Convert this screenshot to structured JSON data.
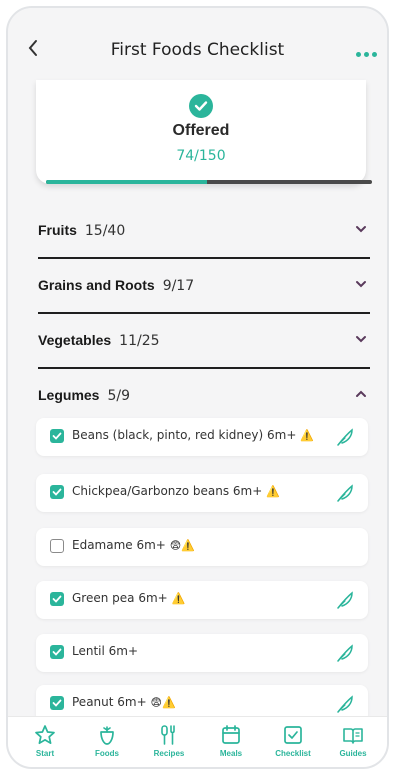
{
  "header": {
    "title": "First Foods Checklist",
    "back_icon": "chevron-left-icon",
    "more_icon": "more-horizontal-icon"
  },
  "summary": {
    "label": "Offered",
    "count": "74/150",
    "progress_fraction": 0.4933
  },
  "sections": [
    {
      "name": "Fruits",
      "count": "15/40",
      "expanded": false
    },
    {
      "name": "Grains and Roots",
      "count": "9/17",
      "expanded": false
    },
    {
      "name": "Vegetables",
      "count": "11/25",
      "expanded": false
    },
    {
      "name": "Legumes",
      "count": "5/9",
      "expanded": true
    }
  ],
  "legumes": [
    {
      "label": "Beans (black, pinto, red kidney) 6m+",
      "flags": "⚠️",
      "checked": true,
      "icon": "leaf-icon"
    },
    {
      "label": "Chickpea/Garbonzo beans 6m+",
      "flags": "⚠️",
      "checked": true,
      "icon": "leaf-icon"
    },
    {
      "label": "Edamame 6m+",
      "flags": "😨⚠️",
      "checked": false,
      "icon": ""
    },
    {
      "label": "Green pea 6m+",
      "flags": "⚠️",
      "checked": true,
      "icon": "leaf-icon"
    },
    {
      "label": "Lentil 6m+",
      "flags": "",
      "checked": true,
      "icon": "leaf-icon"
    },
    {
      "label": "Peanut 6m+",
      "flags": "😨⚠️",
      "checked": true,
      "icon": "leaf-icon"
    }
  ],
  "tabs": [
    {
      "label": "Start",
      "icon": "star-icon"
    },
    {
      "label": "Foods",
      "icon": "food-icon"
    },
    {
      "label": "Recipes",
      "icon": "utensils-icon"
    },
    {
      "label": "Meals",
      "icon": "calendar-icon"
    },
    {
      "label": "Checklist",
      "icon": "checklist-icon"
    },
    {
      "label": "Guides",
      "icon": "book-icon"
    }
  ],
  "colors": {
    "accent": "#2bb59b",
    "background": "#f5f5f6",
    "divider": "#1f1f1f"
  }
}
